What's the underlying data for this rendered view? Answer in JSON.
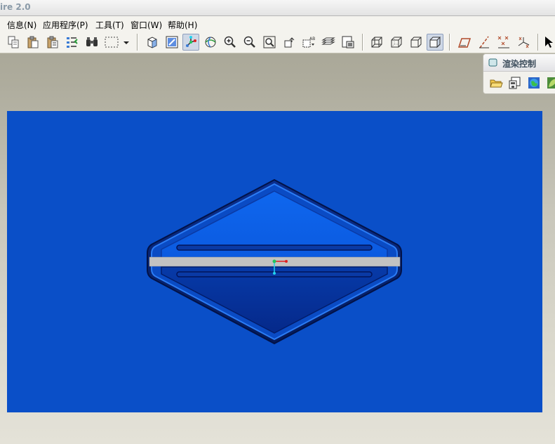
{
  "window": {
    "title": "ire 2.0"
  },
  "menu": {
    "items": [
      {
        "label": "信息(N)"
      },
      {
        "label": "应用程序(P)"
      },
      {
        "label": "工具(T)"
      },
      {
        "label": "窗口(W)"
      },
      {
        "label": "帮助(H)"
      }
    ]
  },
  "toolbar": {
    "icons": [
      "copy-icon",
      "paste-icon",
      "paste-special-icon",
      "regenerate-icon",
      "find-icon",
      "select-box-icon",
      "dropdown-arrow-icon",
      "model-tree-icon",
      "repaint-icon",
      "spin-center-icon",
      "orient-icon",
      "zoom-in-icon",
      "zoom-out-icon",
      "refit-icon",
      "view-reorient-icon",
      "saved-views-icon",
      "layers-icon",
      "view-manager-icon",
      "wireframe-icon",
      "hidden-line-icon",
      "no-hidden-icon",
      "shading-icon",
      "datum-planes-icon",
      "datum-axes-icon",
      "datum-points-icon",
      "csys-icon",
      "select-cursor-icon"
    ],
    "active_spin_center": true,
    "active_shading": true
  },
  "render_panel": {
    "title": "渲染控制",
    "icons": [
      "open-folder-icon",
      "save-scene-icon",
      "globe-render-icon",
      "leaf-render-icon"
    ]
  },
  "colors": {
    "viewport_bg": "#0a4fc8",
    "part_top": "#0d63e8",
    "part_bottom": "#062f9a",
    "datum_plane": "#c2c2c2",
    "accent_red": "#e02020",
    "accent_green": "#22c55e",
    "accent_cyan": "#22d3ee"
  }
}
